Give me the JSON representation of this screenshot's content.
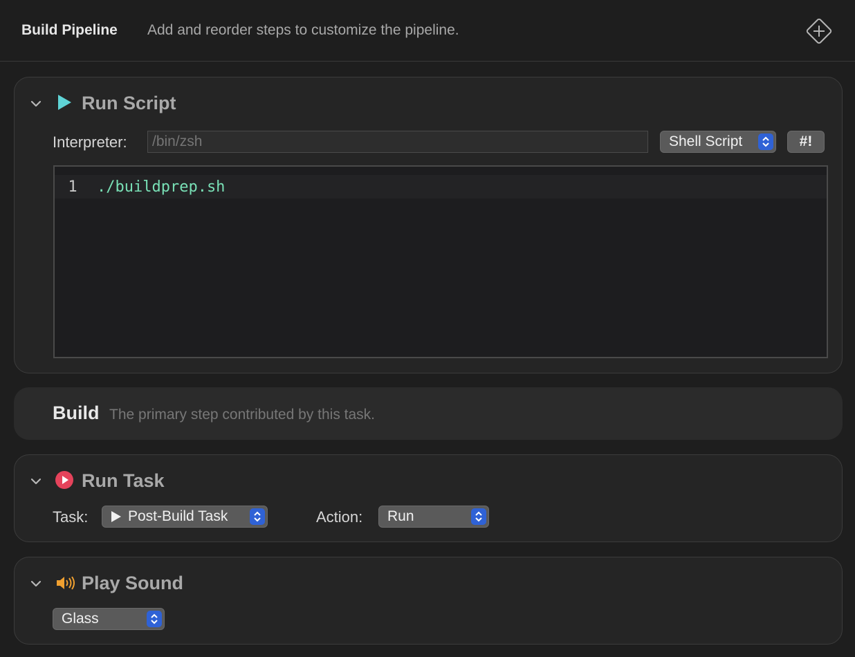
{
  "header": {
    "title": "Build Pipeline",
    "subtitle": "Add and reorder steps to customize the pipeline.",
    "add_icon": "plus-diamond-icon"
  },
  "run_script": {
    "title": "Run Script",
    "icon": "play-triangle-icon",
    "icon_color": "#5fd4d6",
    "interpreter_label": "Interpreter:",
    "interpreter_placeholder": "/bin/zsh",
    "type_popup": "Shell Script",
    "shebang_button": "#!",
    "editor": {
      "line_number": "1",
      "code": "./buildprep.sh"
    }
  },
  "build": {
    "title": "Build",
    "description": "The primary step contributed by this task."
  },
  "run_task": {
    "title": "Run Task",
    "icon": "play-circle-icon",
    "icon_color": "#e5435b",
    "task_label": "Task:",
    "task_value": "Post-Build Task",
    "action_label": "Action:",
    "action_value": "Run"
  },
  "play_sound": {
    "title": "Play Sound",
    "icon": "speaker-icon",
    "icon_color": "#f0a030",
    "sound_value": "Glass"
  }
}
